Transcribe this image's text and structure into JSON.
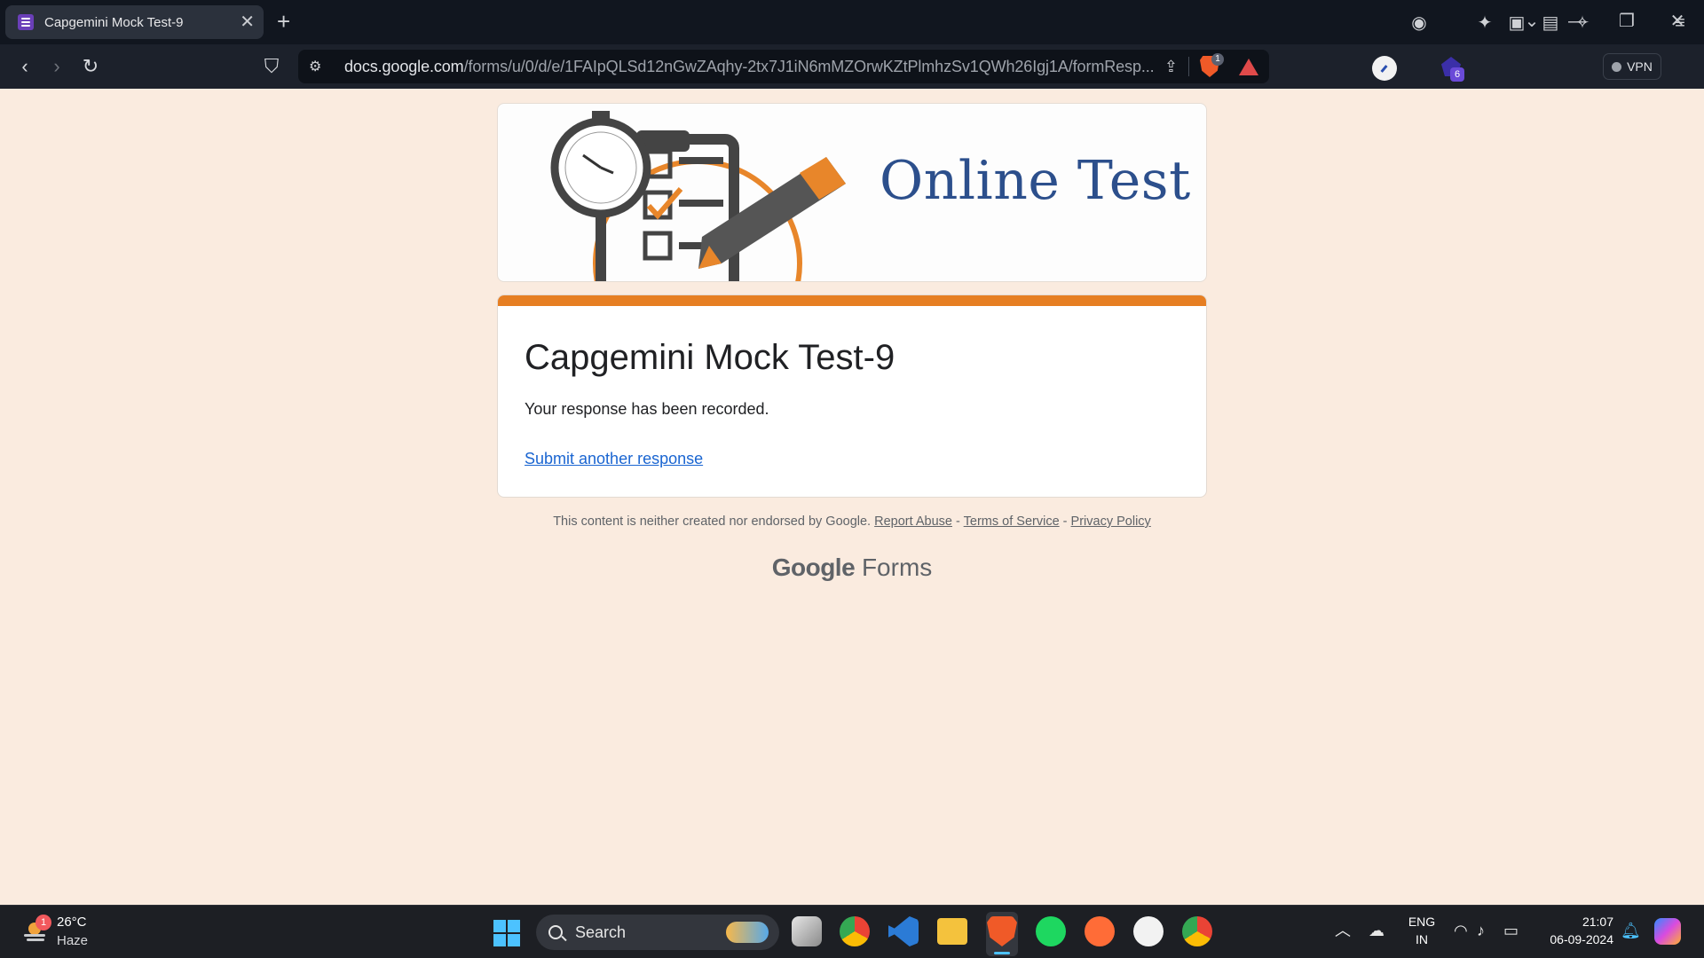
{
  "browser": {
    "tab_title": "Capgemini Mock Test-9",
    "url_host": "docs.google.com",
    "url_path": "/forms/u/0/d/e/1FAIpQLSd12nGwZAqhy-2tx7J1iN6mMZOrwKZtPlmhzSv1QWh26Igj1A/formResp...",
    "shield_count": "1",
    "extension_badge": "6",
    "vpn_label": "VPN"
  },
  "form": {
    "banner_text": "Online Test",
    "title": "Capgemini Mock Test-9",
    "confirmation": "Your response has been recorded.",
    "submit_another": "Submit another response",
    "accent_color": "#e67e22"
  },
  "footer": {
    "disclaimer": "This content is neither created nor endorsed by Google.",
    "report_abuse": "Report Abuse",
    "terms": "Terms of Service",
    "privacy": "Privacy Policy",
    "separator": "-",
    "brand_google": "Google",
    "brand_forms": "Forms"
  },
  "taskbar": {
    "weather_badge": "1",
    "temperature": "26°C",
    "condition": "Haze",
    "search_label": "Search",
    "lang_top": "ENG",
    "lang_bottom": "IN",
    "time": "21:07",
    "date": "06-09-2024"
  }
}
